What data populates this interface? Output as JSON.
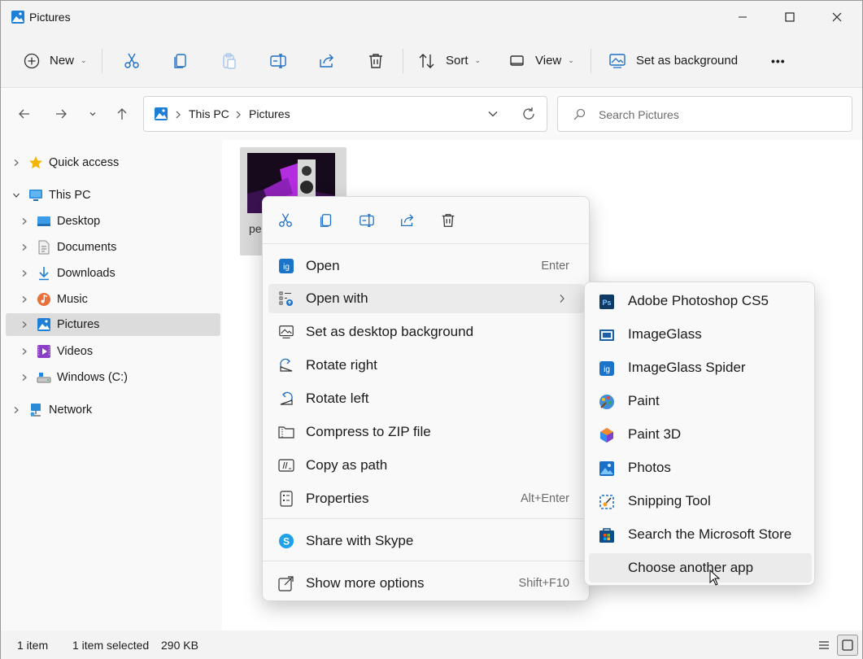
{
  "window": {
    "title": "Pictures"
  },
  "toolbar": {
    "new_label": "New",
    "sort_label": "Sort",
    "view_label": "View",
    "set_background_label": "Set as background",
    "more_label": "•••"
  },
  "address": {
    "crumbs": [
      "This PC",
      "Pictures"
    ]
  },
  "search": {
    "placeholder": "Search Pictures"
  },
  "sidebar": {
    "items": [
      {
        "label": "Quick access",
        "icon": "star-icon"
      },
      {
        "label": "This PC",
        "icon": "monitor-icon"
      },
      {
        "label": "Desktop",
        "icon": "desktop-folder-icon"
      },
      {
        "label": "Documents",
        "icon": "documents-icon"
      },
      {
        "label": "Downloads",
        "icon": "download-arrow-icon"
      },
      {
        "label": "Music",
        "icon": "music-icon"
      },
      {
        "label": "Pictures",
        "icon": "pictures-icon"
      },
      {
        "label": "Videos",
        "icon": "videos-icon"
      },
      {
        "label": "Windows (C:)",
        "icon": "drive-icon"
      },
      {
        "label": "Network",
        "icon": "network-icon"
      }
    ]
  },
  "files": [
    {
      "name": "pe"
    }
  ],
  "context_menu": {
    "items": [
      {
        "label": "Open",
        "shortcut": "Enter"
      },
      {
        "label": "Open with",
        "shortcut": ""
      },
      {
        "label": "Set as desktop background",
        "shortcut": ""
      },
      {
        "label": "Rotate right",
        "shortcut": ""
      },
      {
        "label": "Rotate left",
        "shortcut": ""
      },
      {
        "label": "Compress to ZIP file",
        "shortcut": ""
      },
      {
        "label": "Copy as path",
        "shortcut": ""
      },
      {
        "label": "Properties",
        "shortcut": "Alt+Enter"
      },
      {
        "label": "Share with Skype",
        "shortcut": ""
      },
      {
        "label": "Show more options",
        "shortcut": "Shift+F10"
      }
    ]
  },
  "open_with_menu": {
    "items": [
      {
        "label": "Adobe Photoshop CS5"
      },
      {
        "label": "ImageGlass"
      },
      {
        "label": "ImageGlass Spider"
      },
      {
        "label": "Paint"
      },
      {
        "label": "Paint 3D"
      },
      {
        "label": "Photos"
      },
      {
        "label": "Snipping Tool"
      },
      {
        "label": "Search the Microsoft Store"
      },
      {
        "label": "Choose another app"
      }
    ]
  },
  "status": {
    "item_count": "1 item",
    "selected": "1 item selected",
    "size": "290 KB"
  },
  "colors": {
    "accent": "#0067c0",
    "selection": "#dcdcdc",
    "menu_bg": "#f9f9f9"
  }
}
